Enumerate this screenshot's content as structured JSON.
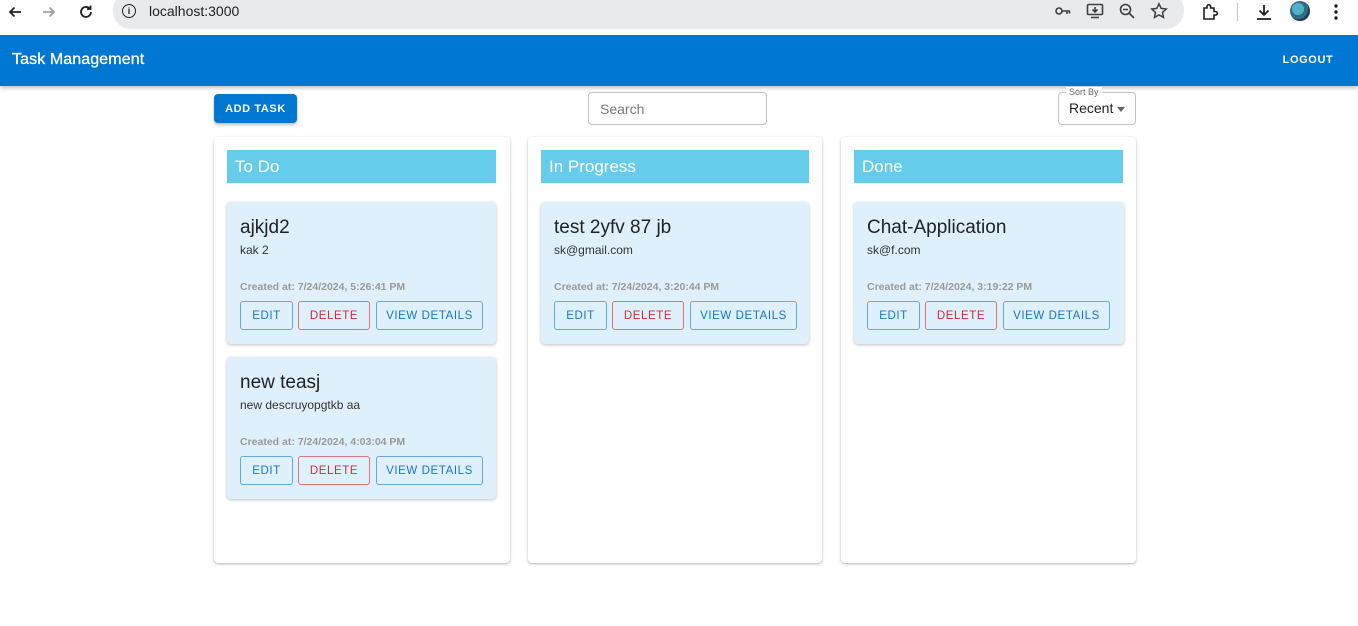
{
  "browser": {
    "url": "localhost:3000"
  },
  "app": {
    "title": "Task Management",
    "logout_label": "LOGOUT"
  },
  "toolbar": {
    "add_task_label": "ADD TASK",
    "search_placeholder": "Search",
    "sort_label": "Sort By",
    "sort_value": "Recent"
  },
  "columns": [
    {
      "title": "To Do",
      "cards": [
        {
          "title": "ajkjd2",
          "description": "kak 2",
          "created": "Created at: 7/24/2024, 5:26:41 PM"
        },
        {
          "title": "new teasj",
          "description": "new descruyopgtkb aa",
          "created": "Created at: 7/24/2024, 4:03:04 PM"
        }
      ]
    },
    {
      "title": "In Progress",
      "cards": [
        {
          "title": "test 2yfv 87 jb",
          "description": "sk@gmail.com",
          "created": "Created at: 7/24/2024, 3:20:44 PM"
        }
      ]
    },
    {
      "title": "Done",
      "cards": [
        {
          "title": "Chat-Application",
          "description": "sk@f.com",
          "created": "Created at: 7/24/2024, 3:19:22 PM"
        }
      ]
    }
  ],
  "buttons": {
    "edit": "EDIT",
    "delete": "DELETE",
    "view": "VIEW DETAILS"
  },
  "colors": {
    "appbar": "#0077d2",
    "column_header": "#65cdeb",
    "card_bg": "#def0fb",
    "delete": "#d22b3a"
  }
}
